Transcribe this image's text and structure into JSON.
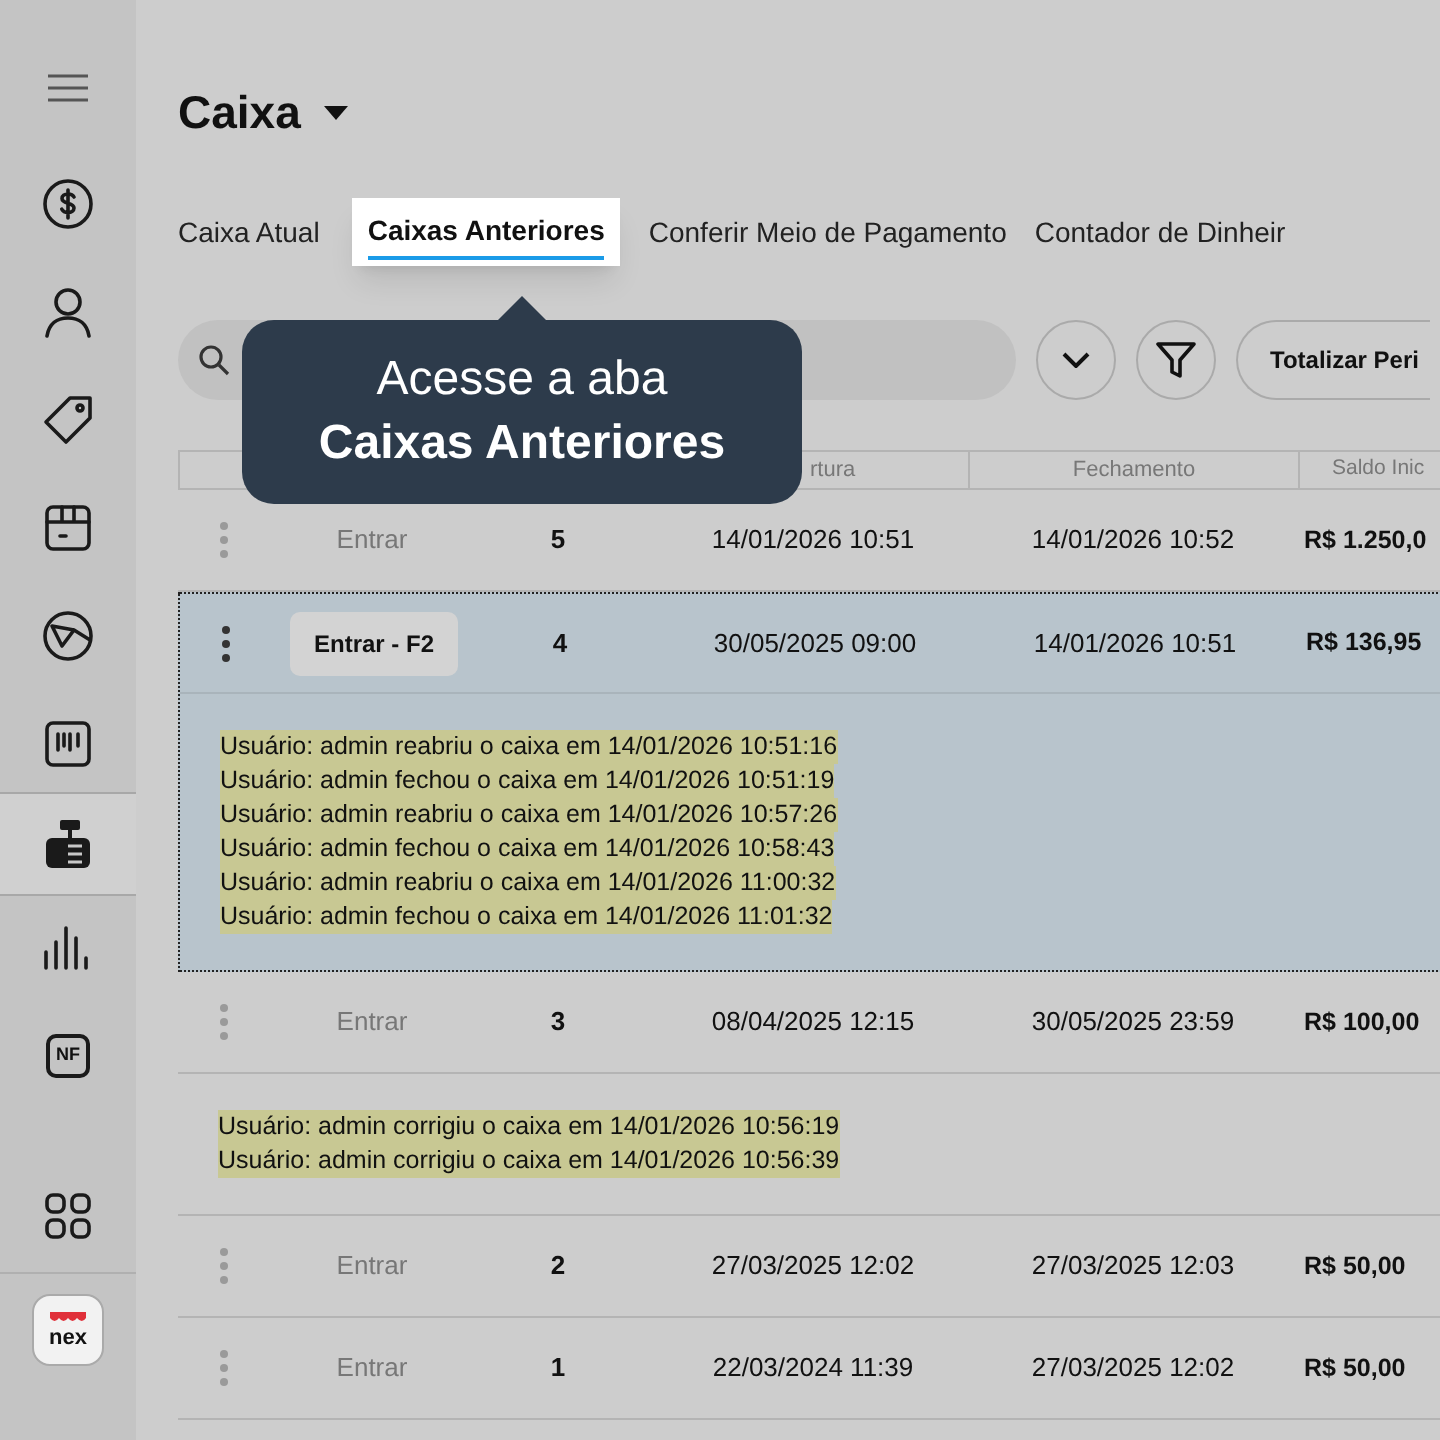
{
  "sidebar": {
    "items": [
      {
        "kind": "menu",
        "selected": false
      },
      {
        "kind": "money",
        "selected": false
      },
      {
        "kind": "user",
        "selected": false
      },
      {
        "kind": "tag",
        "selected": false
      },
      {
        "kind": "box",
        "selected": false
      },
      {
        "kind": "pie",
        "selected": false
      },
      {
        "kind": "barcode",
        "selected": false
      },
      {
        "kind": "register",
        "selected": true
      },
      {
        "kind": "chart",
        "selected": false
      },
      {
        "kind": "nf",
        "label": "NF",
        "selected": false
      },
      {
        "kind": "apps",
        "selected": false
      }
    ],
    "logo": "nex"
  },
  "page_title": "Caixa",
  "tabs": [
    {
      "label": "Caixa Atual",
      "selected": false
    },
    {
      "label": "Caixas Anteriores",
      "selected": true
    },
    {
      "label": "Conferir Meio de Pagamento",
      "selected": false
    },
    {
      "label": "Contador de Dinheir",
      "selected": false
    }
  ],
  "toolbar": {
    "total_button": "Totalizar Peri"
  },
  "tooltip": {
    "line_1": "Acesse a aba",
    "line_2": "Caixas Anteriores"
  },
  "table": {
    "columns": [
      {
        "label": "rtura"
      },
      {
        "label": "Fechamento"
      },
      {
        "label": "Saldo Inic"
      }
    ],
    "rows": [
      {
        "action": "Entrar",
        "number": "5",
        "opened": "14/01/2026 10:51",
        "closed": "14/01/2026 10:52",
        "balance": "R$ 1.250,0",
        "selected": false
      },
      {
        "action": "Entrar - F2",
        "number": "4",
        "opened": "30/05/2025 09:00",
        "closed": "14/01/2026 10:51",
        "balance": "R$ 136,95",
        "selected": true,
        "logs": [
          "Usuário: admin reabriu o caixa em 14/01/2026 10:51:16",
          "Usuário: admin fechou o caixa em 14/01/2026 10:51:19",
          "Usuário: admin reabriu o caixa em 14/01/2026 10:57:26",
          "Usuário: admin fechou o caixa em 14/01/2026 10:58:43",
          "Usuário: admin reabriu o caixa em 14/01/2026 11:00:32",
          "Usuário: admin fechou o caixa em 14/01/2026 11:01:32"
        ]
      },
      {
        "action": "Entrar",
        "number": "3",
        "opened": "08/04/2025 12:15",
        "closed": "30/05/2025 23:59",
        "balance": "R$ 100,00",
        "selected": false,
        "logs": [
          "Usuário: admin corrigiu o caixa em 14/01/2026 10:56:19",
          "Usuário: admin corrigiu o caixa em 14/01/2026 10:56:39"
        ]
      },
      {
        "action": "Entrar",
        "number": "2",
        "opened": "27/03/2025 12:02",
        "closed": "27/03/2025 12:03",
        "balance": "R$ 50,00",
        "selected": false
      },
      {
        "action": "Entrar",
        "number": "1",
        "opened": "22/03/2024 11:39",
        "closed": "27/03/2025 12:02",
        "balance": "R$ 50,00",
        "selected": false
      }
    ]
  }
}
